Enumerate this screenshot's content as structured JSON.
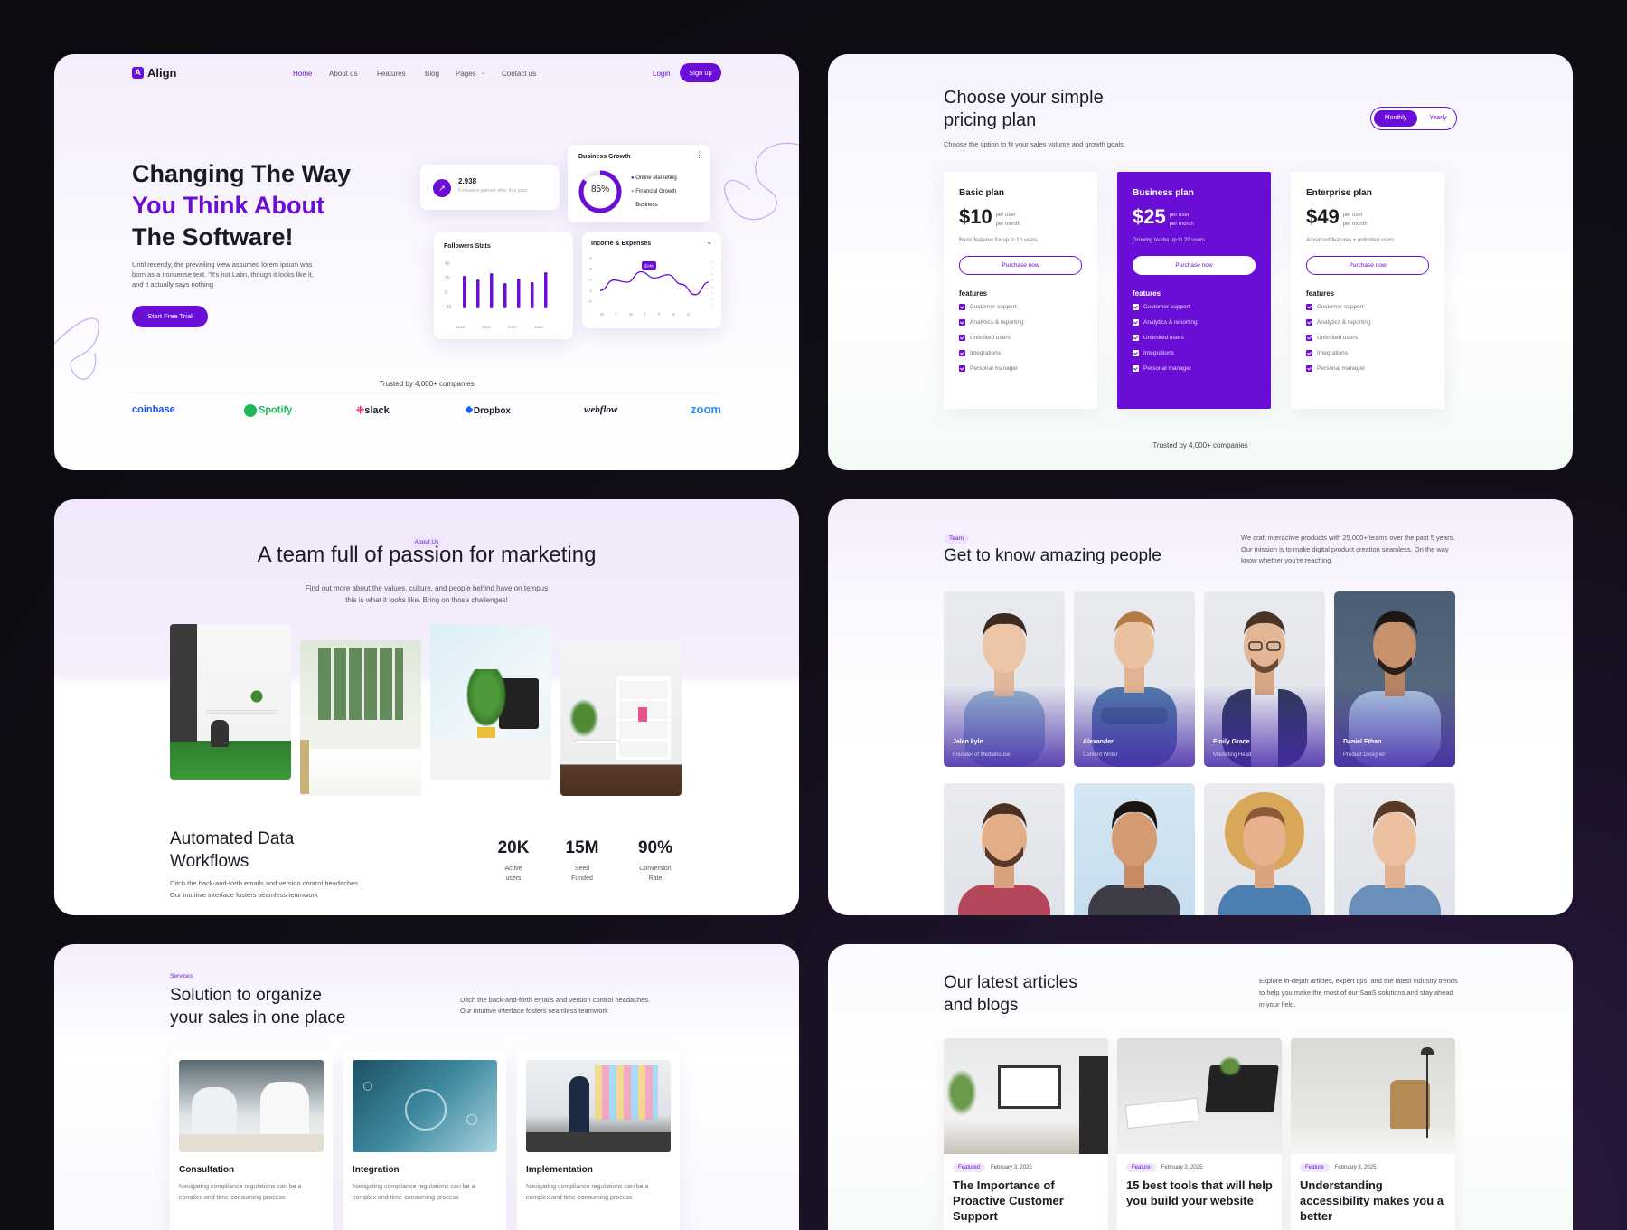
{
  "hero": {
    "logo": "Align",
    "nav": [
      "Home",
      "About us",
      "Features",
      "Blog",
      "Pages",
      "Contact us"
    ],
    "login": "Login",
    "signup": "Sign up",
    "title_l1": "Changing The Way",
    "title_l2": "You Think About",
    "title_l3": "The Software!",
    "desc": "Until recently, the prevailing view assumed lorem ipsum was born as a nonsense text. \"It's not Latin, though it looks like it, and it actually says nothing",
    "cta": "Start Free Trial",
    "stat_value": "2.938",
    "stat_label": "Followers gained after this post",
    "bg_title": "Business Growth",
    "bg_pct": "85%",
    "bg_legend": [
      "Online Marketing",
      "Financial Growth",
      "Business"
    ],
    "fs_title": "Followers Stats",
    "fs_bars": [
      0.72,
      0.64,
      0.78,
      0.56,
      0.66,
      0.58,
      0.8
    ],
    "fs_yticks": [
      "40",
      "20",
      "0",
      "-20"
    ],
    "fs_xticks": [
      "2019",
      "2020",
      "2021",
      "2022"
    ],
    "ie_title": "Income & Expenses",
    "ie_tip": "$24k",
    "ie_line": [
      0.3,
      0.55,
      0.5,
      0.75,
      0.6,
      0.68,
      0.45,
      0.2,
      0.5
    ],
    "ie_xticks": [
      "M",
      "T",
      "W",
      "T",
      "F",
      "S",
      "S"
    ],
    "ie_yticks": [
      "4",
      "3",
      "2",
      "1",
      "0"
    ],
    "trusted": "Trusted by 4,000+ companies",
    "logos": [
      "coinbase",
      "Spotify",
      "slack",
      "Dropbox",
      "webflow",
      "zoom"
    ],
    "logo_colors": [
      "#1652f0",
      "#1db954",
      "#1a1a24",
      "#0061fe",
      "#1a1a24",
      "#2d8cff"
    ]
  },
  "pricing": {
    "title_l1": "Choose your simple",
    "title_l2": "pricing plan",
    "subtitle": "Choose the option to fit your sales volume and growth goals.",
    "toggle": [
      "Monthly",
      "Yearly"
    ],
    "plans": [
      {
        "name": "Basic plan",
        "price": "$10",
        "per1": "per user",
        "per2": "per month",
        "desc": "Basic features for up to 10 users.",
        "btn": "Purchase now",
        "fh": "features"
      },
      {
        "name": "Business plan",
        "price": "$25",
        "per1": "per user",
        "per2": "per month",
        "desc": "Growing teams up to 20 users.",
        "btn": "Purchase now",
        "fh": "features"
      },
      {
        "name": "Enterprise plan",
        "price": "$49",
        "per1": "per user",
        "per2": "per month",
        "desc": "Advanced features + unlimited users.",
        "btn": "Purchase now",
        "fh": "features"
      }
    ],
    "features": [
      "Customer support",
      "Analytics & reporting",
      "Unlimited users",
      "Integrations",
      "Personal manager"
    ],
    "trusted": "Trusted by 4,000+ companies"
  },
  "about": {
    "tag": "About Us",
    "title": "A team full of passion for marketing",
    "desc_l1": "Find out more about the values, culture, and people behind have on tempus",
    "desc_l2": "this is what it looks like. Bring on those challenges!",
    "sub_l1": "Automated Data",
    "sub_l2": "Workflows",
    "sub_desc_l1": "Ditch the back-and-forth emails and version control headaches.",
    "sub_desc_l2": "Our intuitive interface fosters seamless teamwork",
    "stats": [
      {
        "value": "20K",
        "l1": "Active",
        "l2": "users"
      },
      {
        "value": "15M",
        "l1": "Seed",
        "l2": "Funded"
      },
      {
        "value": "90%",
        "l1": "Conversion",
        "l2": "Rate"
      }
    ]
  },
  "team": {
    "tag": "Team",
    "title": "Get to know amazing people",
    "desc": "We craft interactive products with 25,000+ teams over the past 5 years. Our mission is to make digital product creation seamless. On the way know whether you're reaching.",
    "members": [
      {
        "name": "Jalen kyle",
        "role": "Founder of Mediahouse"
      },
      {
        "name": "Alexander",
        "role": "Content Writer"
      },
      {
        "name": "Emily Grace",
        "role": "Marketing Head"
      },
      {
        "name": "Daniel Ethan",
        "role": "Product Designer"
      }
    ]
  },
  "services": {
    "tag": "Services",
    "title_l1": "Solution to organize",
    "title_l2": "your sales in one place",
    "desc_l1": "Ditch the back-and-forth emails and version control headaches.",
    "desc_l2": "Our intuitive interface fosters seamless teamwork",
    "items": [
      {
        "title": "Consultation",
        "desc": "Navigating compliance regulations can be a complex and time-consuming process"
      },
      {
        "title": "Integration",
        "desc": "Navigating compliance regulations can be a complex and time-consuming process"
      },
      {
        "title": "Implementation",
        "desc": "Navigating compliance regulations can be a complex and time-consuming process"
      }
    ]
  },
  "blog": {
    "title_l1": "Our latest articles",
    "title_l2": "and blogs",
    "desc": "Explore in-depth articles, expert tips, and the latest industry trends to help you make the most of our SaaS solutions and stay ahead in your field.",
    "posts": [
      {
        "tag": "Featured",
        "date": "February 3, 2025",
        "title": "The Importance of Proactive Customer Support"
      },
      {
        "tag": "Feature",
        "date": "February 3, 2025",
        "title": "15 best tools that will help you build your website"
      },
      {
        "tag": "Feature",
        "date": "February 3, 2025",
        "title": "Understanding accessibility makes you a better"
      }
    ]
  }
}
